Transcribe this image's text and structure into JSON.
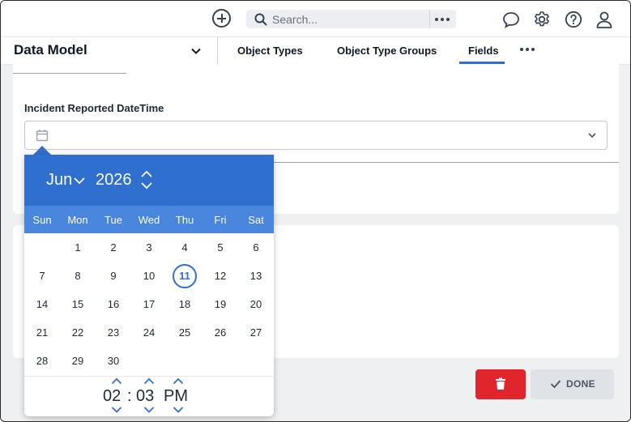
{
  "topbar": {
    "search_placeholder": "Search...",
    "icons": [
      "add-circle-icon",
      "search-icon",
      "more-icon",
      "chat-icon",
      "gear-icon",
      "help-icon",
      "user-icon"
    ]
  },
  "nav": {
    "title": "Data Model",
    "tabs": [
      {
        "label": "Object Types"
      },
      {
        "label": "Object Type Groups"
      },
      {
        "label": "Fields",
        "active": true
      }
    ]
  },
  "form": {
    "field_label": "Incident Reported DateTime",
    "field_value": ""
  },
  "datepicker": {
    "month": "Jun",
    "year": "2026",
    "weekdays": [
      "Sun",
      "Mon",
      "Tue",
      "Wed",
      "Thu",
      "Fri",
      "Sat"
    ],
    "selected_day": 11,
    "days": [
      "1",
      "2",
      "3",
      "4",
      "5",
      "6",
      "7",
      "8",
      "9",
      "10",
      "11",
      "12",
      "13",
      "14",
      "15",
      "16",
      "17",
      "18",
      "19",
      "20",
      "21",
      "22",
      "23",
      "24",
      "25",
      "26",
      "27",
      "28",
      "29",
      "30"
    ],
    "time": {
      "hour": "02",
      "separator": ":",
      "minute": "03",
      "period": "PM"
    }
  },
  "buttons": {
    "done_label": "DONE"
  },
  "colors": {
    "accent": "#2f6fce",
    "accent_light": "#4a86de",
    "danger": "#e0252c",
    "secondary_button": "#dfe2e6",
    "background": "#eef0f2"
  }
}
